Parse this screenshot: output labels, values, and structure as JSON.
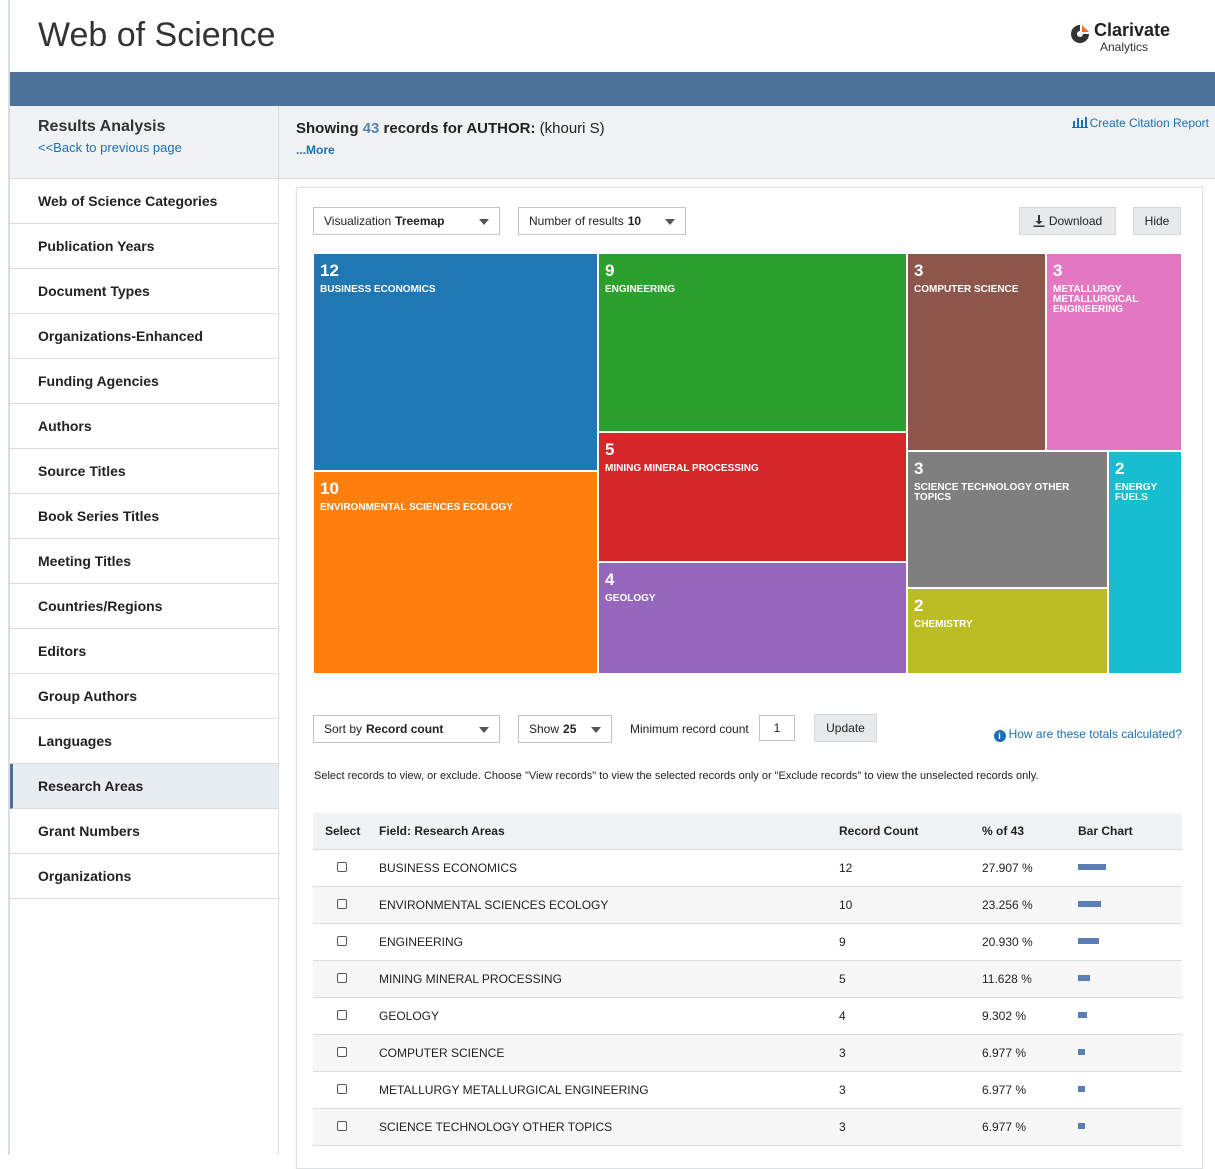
{
  "app": {
    "title": "Web of Science",
    "brand_name": "Clarivate",
    "brand_sub": "Analytics"
  },
  "subheader": {
    "title": "Results Analysis",
    "back_link": "<<Back to previous page",
    "showing_prefix": "Showing ",
    "record_count": "43",
    "showing_mid": " records for AUTHOR: ",
    "query": "(khouri S)",
    "more_link": "...More",
    "citation_report": "Create Citation Report"
  },
  "sidebar": {
    "items": [
      {
        "label": "Web of Science Categories"
      },
      {
        "label": "Publication Years"
      },
      {
        "label": "Document Types"
      },
      {
        "label": "Organizations-Enhanced"
      },
      {
        "label": "Funding Agencies"
      },
      {
        "label": "Authors"
      },
      {
        "label": "Source Titles"
      },
      {
        "label": "Book Series Titles"
      },
      {
        "label": "Meeting Titles"
      },
      {
        "label": "Countries/Regions"
      },
      {
        "label": "Editors"
      },
      {
        "label": "Group Authors"
      },
      {
        "label": "Languages"
      },
      {
        "label": "Research Areas",
        "active": true
      },
      {
        "label": "Grant Numbers"
      },
      {
        "label": "Organizations"
      }
    ]
  },
  "controls": {
    "visualization_label": "Visualization",
    "visualization_value": "Treemap",
    "num_results_label": "Number of results",
    "num_results_value": "10",
    "download_label": "Download",
    "hide_label": "Hide",
    "sort_label": "Sort by",
    "sort_value": "Record count",
    "show_label": "Show",
    "show_value": "25",
    "min_count_label": "Minimum record count",
    "min_count_value": "1",
    "update_label": "Update",
    "help_link": "How are these totals calculated?",
    "instructions": "Select records to view, or exclude. Choose \"View records\" to view the selected records only or \"Exclude records\" to view the unselected records only."
  },
  "colors": {
    "topbar": "#4b7398",
    "link": "#1a6fb5",
    "bar": "#5b7fb5"
  },
  "chart_data": {
    "type": "treemap",
    "total": 43,
    "items": [
      {
        "label": "BUSINESS ECONOMICS",
        "value": 12,
        "color": "#1f77b4"
      },
      {
        "label": "ENVIRONMENTAL SCIENCES ECOLOGY",
        "value": 10,
        "color": "#ff7f0e"
      },
      {
        "label": "ENGINEERING",
        "value": 9,
        "color": "#2ca02c"
      },
      {
        "label": "MINING MINERAL PROCESSING",
        "value": 5,
        "color": "#d62728"
      },
      {
        "label": "GEOLOGY",
        "value": 4,
        "color": "#9467bd"
      },
      {
        "label": "COMPUTER SCIENCE",
        "value": 3,
        "color": "#8c564b"
      },
      {
        "label": "METALLURGY METALLURGICAL ENGINEERING",
        "value": 3,
        "color": "#e377c2"
      },
      {
        "label": "SCIENCE TECHNOLOGY OTHER TOPICS",
        "value": 3,
        "color": "#7f7f7f"
      },
      {
        "label": "CHEMISTRY",
        "value": 2,
        "color": "#bcbd22"
      },
      {
        "label": "ENERGY FUELS",
        "value": 2,
        "color": "#17becf"
      }
    ]
  },
  "table": {
    "headers": {
      "select": "Select",
      "field": "Field: Research Areas",
      "count": "Record Count",
      "pct": "% of 43",
      "bar": "Bar Chart"
    },
    "rows": [
      {
        "field": "BUSINESS ECONOMICS",
        "count": "12",
        "pct": "27.907 %",
        "pct_value": 27.907
      },
      {
        "field": "ENVIRONMENTAL SCIENCES ECOLOGY",
        "count": "10",
        "pct": "23.256 %",
        "pct_value": 23.256
      },
      {
        "field": "ENGINEERING",
        "count": "9",
        "pct": "20.930 %",
        "pct_value": 20.93
      },
      {
        "field": "MINING MINERAL PROCESSING",
        "count": "5",
        "pct": "11.628 %",
        "pct_value": 11.628
      },
      {
        "field": "GEOLOGY",
        "count": "4",
        "pct": "9.302 %",
        "pct_value": 9.302
      },
      {
        "field": "COMPUTER SCIENCE",
        "count": "3",
        "pct": "6.977 %",
        "pct_value": 6.977
      },
      {
        "field": "METALLURGY METALLURGICAL ENGINEERING",
        "count": "3",
        "pct": "6.977 %",
        "pct_value": 6.977
      },
      {
        "field": "SCIENCE TECHNOLOGY OTHER TOPICS",
        "count": "3",
        "pct": "6.977 %",
        "pct_value": 6.977
      }
    ]
  }
}
